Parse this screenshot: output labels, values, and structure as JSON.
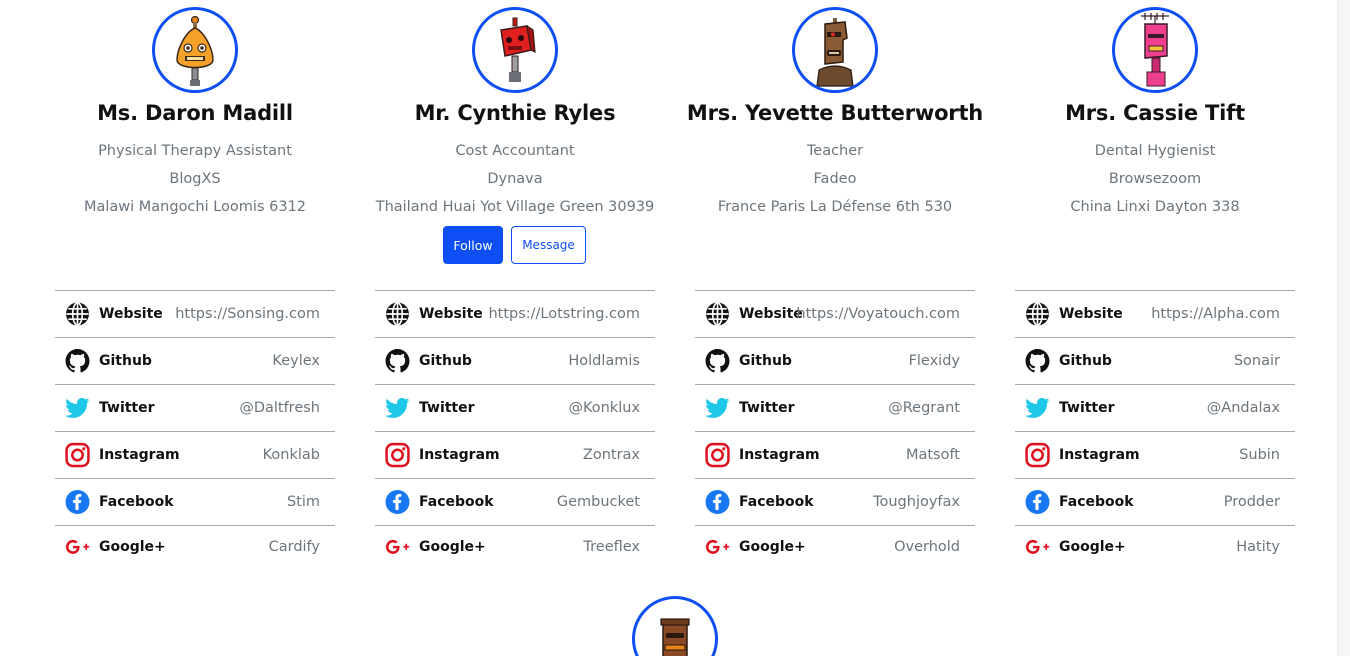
{
  "colors": {
    "accent": "#0d4ef5",
    "text_primary": "#111111",
    "text_muted": "#6c757d",
    "divider": "#a9a9a9",
    "twitter": "#1dc7e8",
    "instagram": "#e0101f",
    "facebook": "#1877f2",
    "google": "#e0101f"
  },
  "profiles": [
    {
      "name": "Ms. Daron Madill",
      "title": "Physical Therapy Assistant",
      "company": "BlogXS",
      "address": "Malawi Mangochi Loomis 6312",
      "avatar_icon": "orange-robot-icon",
      "social": {
        "website": {
          "label": "Website",
          "value": "https://Sonsing.com"
        },
        "github": {
          "label": "Github",
          "value": "Keylex"
        },
        "twitter": {
          "label": "Twitter",
          "value": "@Daltfresh"
        },
        "instagram": {
          "label": "Instagram",
          "value": "Konklab"
        },
        "facebook": {
          "label": "Facebook",
          "value": "Stim"
        },
        "google": {
          "label": "Google+",
          "value": "Cardify"
        }
      }
    },
    {
      "name": "Mr. Cynthie Ryles",
      "title": "Cost Accountant",
      "company": "Dynava",
      "address": "Thailand Huai Yot Village Green 30939",
      "avatar_icon": "red-robot-icon",
      "follow_label": "Follow",
      "message_label": "Message",
      "social": {
        "website": {
          "label": "Website",
          "value": "https://Lotstring.com"
        },
        "github": {
          "label": "Github",
          "value": "Holdlamis"
        },
        "twitter": {
          "label": "Twitter",
          "value": "@Konklux"
        },
        "instagram": {
          "label": "Instagram",
          "value": "Zontrax"
        },
        "facebook": {
          "label": "Facebook",
          "value": "Gembucket"
        },
        "google": {
          "label": "Google+",
          "value": "Treeflex"
        }
      }
    },
    {
      "name": "Mrs. Yevette Butterworth",
      "title": "Teacher",
      "company": "Fadeo",
      "address": "France Paris La Défense 6th 530",
      "avatar_icon": "brown-robot-icon",
      "social": {
        "website": {
          "label": "Website",
          "value": "https://Voyatouch.com"
        },
        "github": {
          "label": "Github",
          "value": "Flexidy"
        },
        "twitter": {
          "label": "Twitter",
          "value": "@Regrant"
        },
        "instagram": {
          "label": "Instagram",
          "value": "Matsoft"
        },
        "facebook": {
          "label": "Facebook",
          "value": "Toughjoyfax"
        },
        "google": {
          "label": "Google+",
          "value": "Overhold"
        }
      }
    },
    {
      "name": "Mrs. Cassie Tift",
      "title": "Dental Hygienist",
      "company": "Browsezoom",
      "address": "China Linxi Dayton 338",
      "avatar_icon": "pink-robot-icon",
      "social": {
        "website": {
          "label": "Website",
          "value": "https://Alpha.com"
        },
        "github": {
          "label": "Github",
          "value": "Sonair"
        },
        "twitter": {
          "label": "Twitter",
          "value": "@Andalax"
        },
        "instagram": {
          "label": "Instagram",
          "value": "Subin"
        },
        "facebook": {
          "label": "Facebook",
          "value": "Prodder"
        },
        "google": {
          "label": "Google+",
          "value": "Hatity"
        }
      }
    }
  ],
  "next_profile": {
    "avatar_icon": "rust-robot-icon"
  }
}
